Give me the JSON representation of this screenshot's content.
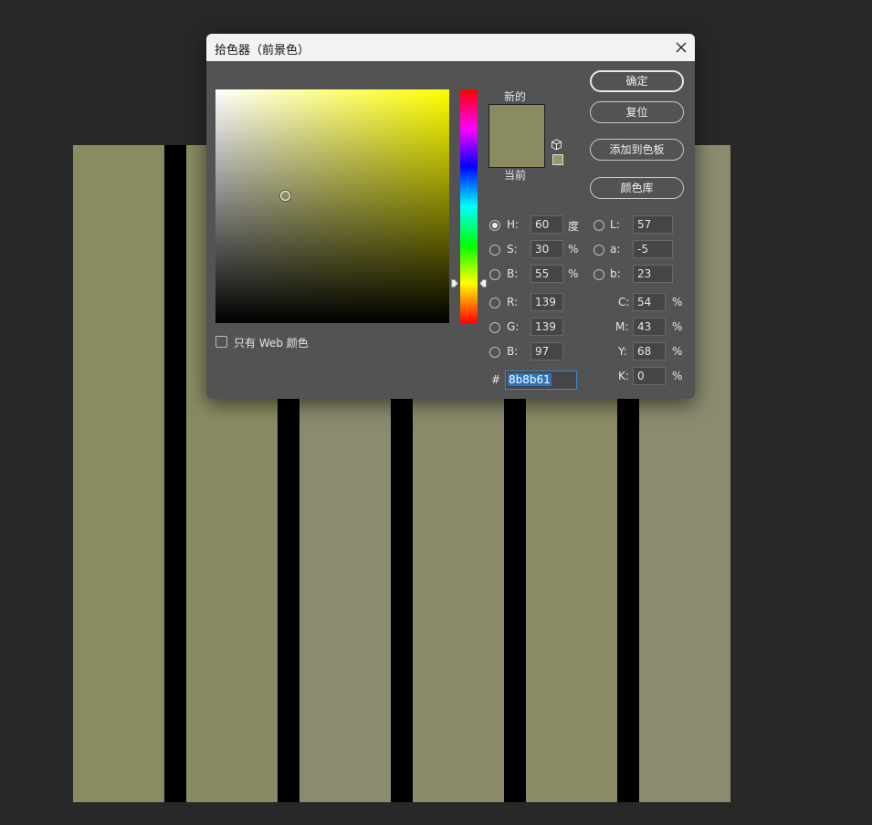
{
  "dialog": {
    "title": "拾色器（前景色）",
    "close_icon": "close-icon"
  },
  "picker": {
    "hue_color": "#ffff00",
    "marker_color": "#8b8b61"
  },
  "preview": {
    "new_label": "新的",
    "current_label": "当前",
    "new_color": "#8b8b61",
    "current_color": "#8b8b61"
  },
  "buttons": {
    "ok": "确定",
    "reset": "复位",
    "add_to_swatches": "添加到色板",
    "color_libraries": "颜色库"
  },
  "hsb": {
    "h_label": "H:",
    "h_value": "60",
    "h_unit": "度",
    "s_label": "S:",
    "s_value": "30",
    "s_unit": "%",
    "b_label": "B:",
    "b_value": "55",
    "b_unit": "%"
  },
  "lab": {
    "l_label": "L:",
    "l_value": "57",
    "a_label": "a:",
    "a_value": "-5",
    "b_label": "b:",
    "b_value": "23"
  },
  "rgb": {
    "r_label": "R:",
    "r_value": "139",
    "g_label": "G:",
    "g_value": "139",
    "b_label": "B:",
    "b_value": "97"
  },
  "cmyk": {
    "c_label": "C:",
    "c_value": "54",
    "c_unit": "%",
    "m_label": "M:",
    "m_value": "43",
    "m_unit": "%",
    "y_label": "Y:",
    "y_value": "68",
    "y_unit": "%",
    "k_label": "K:",
    "k_value": "0",
    "k_unit": "%"
  },
  "hex": {
    "label": "#",
    "value": "8b8b61"
  },
  "web_only": {
    "label": "只有 Web 颜色",
    "checked": false
  },
  "canvas": {
    "stripe_colors": [
      "#8b8b61",
      "#8a8a62",
      "#8a8b6f",
      "#8b8b6a",
      "#8b8b65",
      "#8b8b6f"
    ],
    "bar_color": "#000000"
  }
}
